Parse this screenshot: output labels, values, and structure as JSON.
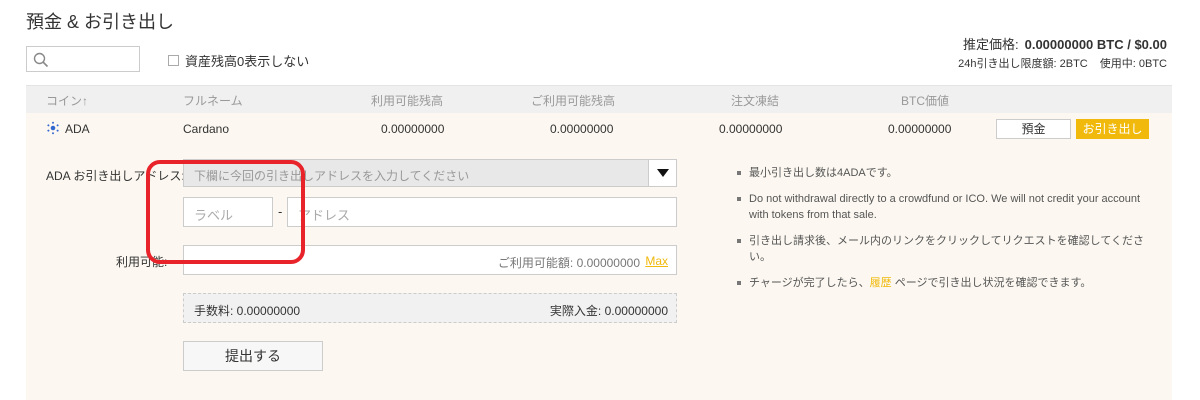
{
  "page": {
    "title": "預金 & お引き出し"
  },
  "search": {
    "value": ""
  },
  "filters": {
    "hide_zero_label": "資産残高0表示しない"
  },
  "summary": {
    "estimated_label": "推定価格:",
    "estimated_value": "0.00000000 BTC / $0.00",
    "limit_label": "24h引き出し限度額: 2BTC",
    "used_label": "使用中: 0BTC"
  },
  "table": {
    "headers": [
      "コイン↑",
      "フルネーム",
      "利用可能残高",
      "ご利用可能残高",
      "注文凍結",
      "BTC価値"
    ],
    "row": {
      "coin": "ADA",
      "fullname": "Cardano",
      "available": "0.00000000",
      "available2": "0.00000000",
      "frozen": "0.00000000",
      "btc_value": "0.00000000",
      "deposit_label": "預金",
      "withdraw_label": "お引き出し"
    }
  },
  "withdraw_form": {
    "address_label": "ADA お引き出しアドレス:",
    "address_select_placeholder": "下欄に今回の引き出しアドレスを入力してください",
    "label_placeholder": "ラベル",
    "dash": "-",
    "address_placeholder": "アドレス",
    "amount_label": "利用可能:",
    "available_text": "ご利用可能額: 0.00000000",
    "max_label": "Max",
    "fee_text": "手数料: 0.00000000",
    "net_text": "実際入金: 0.00000000",
    "submit_label": "提出する"
  },
  "notes": {
    "n1": "最小引き出し数は4ADAです。",
    "n2": "Do not withdrawal directly to a crowdfund or ICO. We will not credit your account with tokens from that sale.",
    "n3": "引き出し請求後、メール内のリンクをクリックしてリクエストを確認してください。",
    "n4_pre": "チャージが完了したら、",
    "n4_link": "履歴",
    "n4_post": " ページで引き出し状況を確認できます。"
  },
  "colors": {
    "accent": "#f0b90b",
    "highlight": "#e8232a",
    "panel_bg": "#fcf8f1"
  }
}
